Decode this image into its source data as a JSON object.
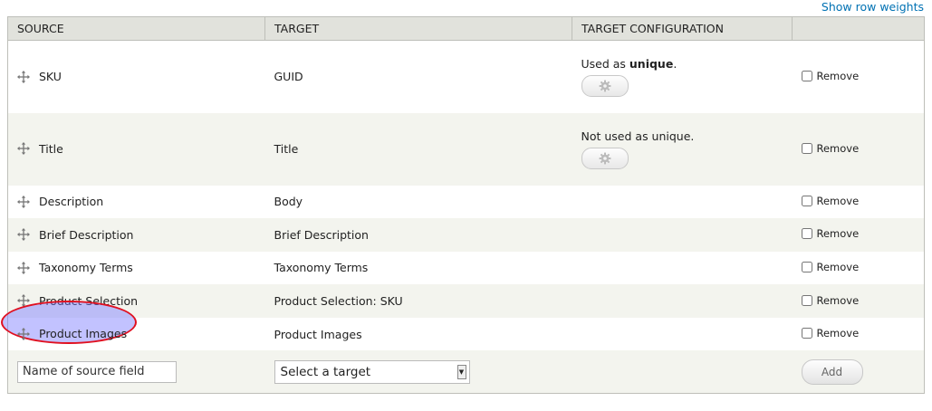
{
  "toolbar": {
    "row_weights_link": "Show row weights"
  },
  "table": {
    "headers": [
      "SOURCE",
      "TARGET",
      "TARGET CONFIGURATION",
      ""
    ],
    "rows": [
      {
        "source": "SKU",
        "target": "GUID",
        "config_text_pre": "Used as ",
        "config_text_bold": "unique",
        "config_text_post": ".",
        "remove_label": "Remove"
      },
      {
        "source": "Title",
        "target": "Title",
        "config_text_pre": "Not used as unique.",
        "config_text_bold": "",
        "config_text_post": "",
        "remove_label": "Remove"
      },
      {
        "source": "Description",
        "target": "Body",
        "remove_label": "Remove"
      },
      {
        "source": "Brief Description",
        "target": "Brief Description",
        "remove_label": "Remove"
      },
      {
        "source": "Taxonomy Terms",
        "target": "Taxonomy Terms",
        "remove_label": "Remove"
      },
      {
        "source": "Product Selection",
        "target": "Product Selection: SKU",
        "remove_label": "Remove"
      },
      {
        "source": "Product Images",
        "target": "Product Images",
        "remove_label": "Remove"
      }
    ],
    "add_row": {
      "source_placeholder": "Name of source field",
      "target_selected": "Select a target",
      "add_label": "Add"
    }
  },
  "icons": {
    "handle": "drag-handle-icon",
    "config": "gear-icon"
  },
  "colors": {
    "link": "#0071b3",
    "header_bg": "#e1e2dc",
    "stripe": "#f3f4ee",
    "highlight_ring": "#e01020"
  }
}
